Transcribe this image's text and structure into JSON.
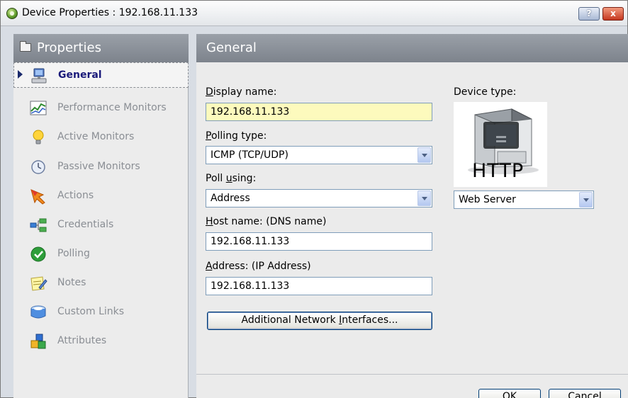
{
  "window": {
    "title": "Device Properties : 192.168.11.133",
    "help_label": "?",
    "close_label": "x"
  },
  "sidebar": {
    "title": "Properties",
    "items": [
      {
        "label": "General",
        "icon": "computer-icon",
        "selected": true
      },
      {
        "label": "Performance Monitors",
        "icon": "chart-icon"
      },
      {
        "label": "Active Monitors",
        "icon": "lightbulb-icon"
      },
      {
        "label": "Passive Monitors",
        "icon": "clock-icon"
      },
      {
        "label": "Actions",
        "icon": "action-arrow-icon"
      },
      {
        "label": "Credentials",
        "icon": "network-icon"
      },
      {
        "label": "Polling",
        "icon": "checkmark-icon"
      },
      {
        "label": "Notes",
        "icon": "pencil-note-icon"
      },
      {
        "label": "Custom Links",
        "icon": "links-icon"
      },
      {
        "label": "Attributes",
        "icon": "blocks-icon"
      }
    ]
  },
  "main": {
    "title": "General",
    "display_name": {
      "label_ul": "D",
      "label_rest": "isplay name:",
      "value": "192.168.11.133"
    },
    "polling_type": {
      "label_ul": "P",
      "label_rest": "olling type:",
      "value": "ICMP (TCP/UDP)"
    },
    "poll_using": {
      "label_pre": "Poll ",
      "label_ul": "u",
      "label_rest": "sing:",
      "value": "Address"
    },
    "host_name": {
      "label_ul": "H",
      "label_rest": "ost name: (DNS name)",
      "value": "192.168.11.133"
    },
    "address": {
      "label_ul": "A",
      "label_rest": "ddress: (IP Address)",
      "value": "192.168.11.133"
    },
    "additional_button": {
      "label_pre": "Additional Network ",
      "label_ul": "I",
      "label_rest": "nterfaces..."
    },
    "device_type": {
      "label": "Device type:",
      "image_text": "HTTP",
      "value": "Web Server"
    }
  },
  "footer": {
    "ok_label": "OK",
    "cancel_label": "Cancel"
  }
}
